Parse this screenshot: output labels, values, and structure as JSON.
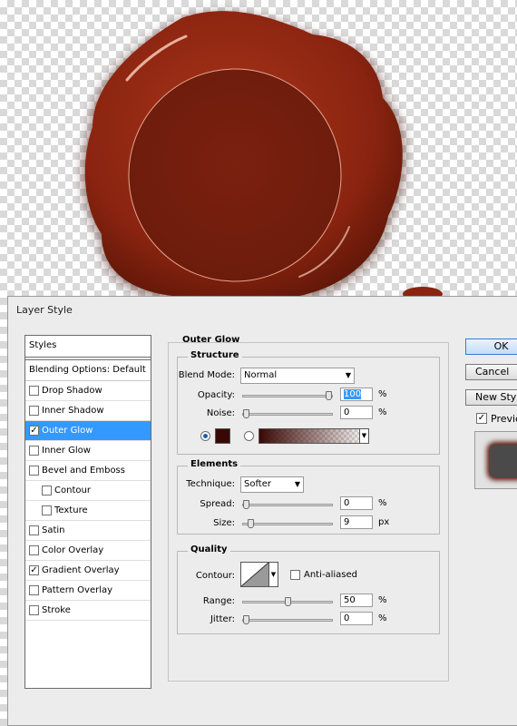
{
  "dialog": {
    "title": "Layer Style"
  },
  "styles_panel": {
    "header": "Styles",
    "blending_options": "Blending Options: Default",
    "items": [
      {
        "label": "Drop Shadow",
        "checked": false,
        "sub": false,
        "active": false
      },
      {
        "label": "Inner Shadow",
        "checked": false,
        "sub": false,
        "active": false
      },
      {
        "label": "Outer Glow",
        "checked": true,
        "sub": false,
        "active": true
      },
      {
        "label": "Inner Glow",
        "checked": false,
        "sub": false,
        "active": false
      },
      {
        "label": "Bevel and Emboss",
        "checked": false,
        "sub": false,
        "active": false
      },
      {
        "label": "Contour",
        "checked": false,
        "sub": true,
        "active": false
      },
      {
        "label": "Texture",
        "checked": false,
        "sub": true,
        "active": false
      },
      {
        "label": "Satin",
        "checked": false,
        "sub": false,
        "active": false
      },
      {
        "label": "Color Overlay",
        "checked": false,
        "sub": false,
        "active": false
      },
      {
        "label": "Gradient Overlay",
        "checked": true,
        "sub": false,
        "active": false
      },
      {
        "label": "Pattern Overlay",
        "checked": false,
        "sub": false,
        "active": false
      },
      {
        "label": "Stroke",
        "checked": false,
        "sub": false,
        "active": false
      }
    ]
  },
  "outer_glow": {
    "title": "Outer Glow",
    "structure": {
      "title": "Structure",
      "blend_mode_label": "Blend Mode:",
      "blend_mode_value": "Normal",
      "opacity_label": "Opacity:",
      "opacity_value": "100",
      "opacity_unit": "%",
      "opacity_fraction": 1.0,
      "noise_label": "Noise:",
      "noise_value": "0",
      "noise_unit": "%",
      "noise_fraction": 0.0,
      "glow_color": "#3a0804",
      "gradient_radio_selected": false,
      "color_radio_selected": true
    },
    "elements": {
      "title": "Elements",
      "technique_label": "Technique:",
      "technique_value": "Softer",
      "spread_label": "Spread:",
      "spread_value": "0",
      "spread_unit": "%",
      "spread_fraction": 0.0,
      "size_label": "Size:",
      "size_value": "9",
      "size_unit": "px",
      "size_fraction": 0.05
    },
    "quality": {
      "title": "Quality",
      "contour_label": "Contour:",
      "anti_aliased_label": "Anti-aliased",
      "anti_aliased_checked": false,
      "range_label": "Range:",
      "range_value": "50",
      "range_unit": "%",
      "range_fraction": 0.5,
      "jitter_label": "Jitter:",
      "jitter_value": "0",
      "jitter_unit": "%",
      "jitter_fraction": 0.0
    }
  },
  "buttons": {
    "ok": "OK",
    "cancel": "Cancel",
    "new_style": "New Style",
    "preview": "Preview",
    "preview_checked": true
  },
  "colors": {
    "wax": "#8a2410",
    "wax_dark": "#6a1a0a",
    "accent": "#3399ff"
  }
}
